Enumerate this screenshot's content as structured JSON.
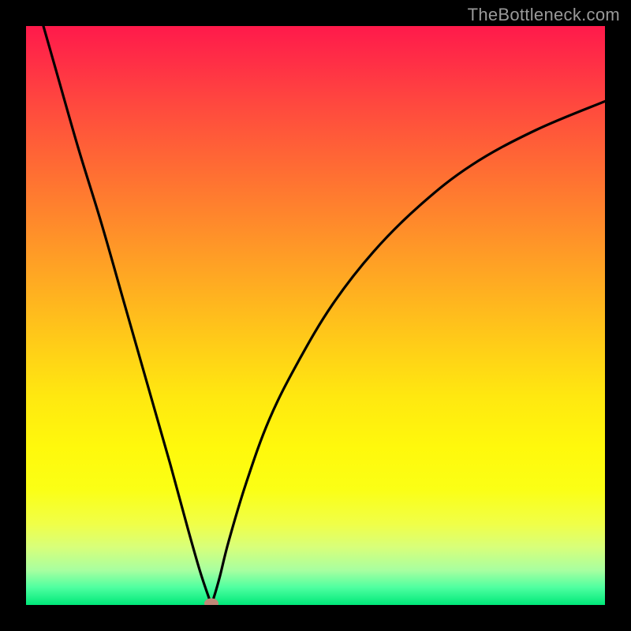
{
  "watermark": "TheBottleneck.com",
  "chart_data": {
    "type": "line",
    "title": "",
    "xlabel": "",
    "ylabel": "",
    "xlim": [
      0,
      100
    ],
    "ylim": [
      0,
      100
    ],
    "grid": false,
    "series": [
      {
        "name": "bottleneck-curve",
        "x": [
          3,
          5,
          9,
          13,
          17,
          21,
          25,
          28,
          30,
          31.5,
          32,
          32.5,
          33.5,
          35,
          38,
          42,
          47,
          53,
          60,
          68,
          77,
          88,
          100
        ],
        "y": [
          100,
          93,
          79,
          66,
          52,
          38,
          24,
          13,
          6,
          1.5,
          0.3,
          1.5,
          5,
          11,
          21,
          32,
          42,
          52,
          61,
          69,
          76,
          82,
          87
        ]
      }
    ],
    "marker": {
      "x": 32,
      "y": 0.3,
      "color": "#c08878"
    },
    "background": {
      "type": "vertical-gradient",
      "stops": [
        {
          "pos": 0.0,
          "color": "#ff1a4b"
        },
        {
          "pos": 0.5,
          "color": "#ffd017"
        },
        {
          "pos": 0.8,
          "color": "#fbff15"
        },
        {
          "pos": 1.0,
          "color": "#00e879"
        }
      ]
    }
  }
}
